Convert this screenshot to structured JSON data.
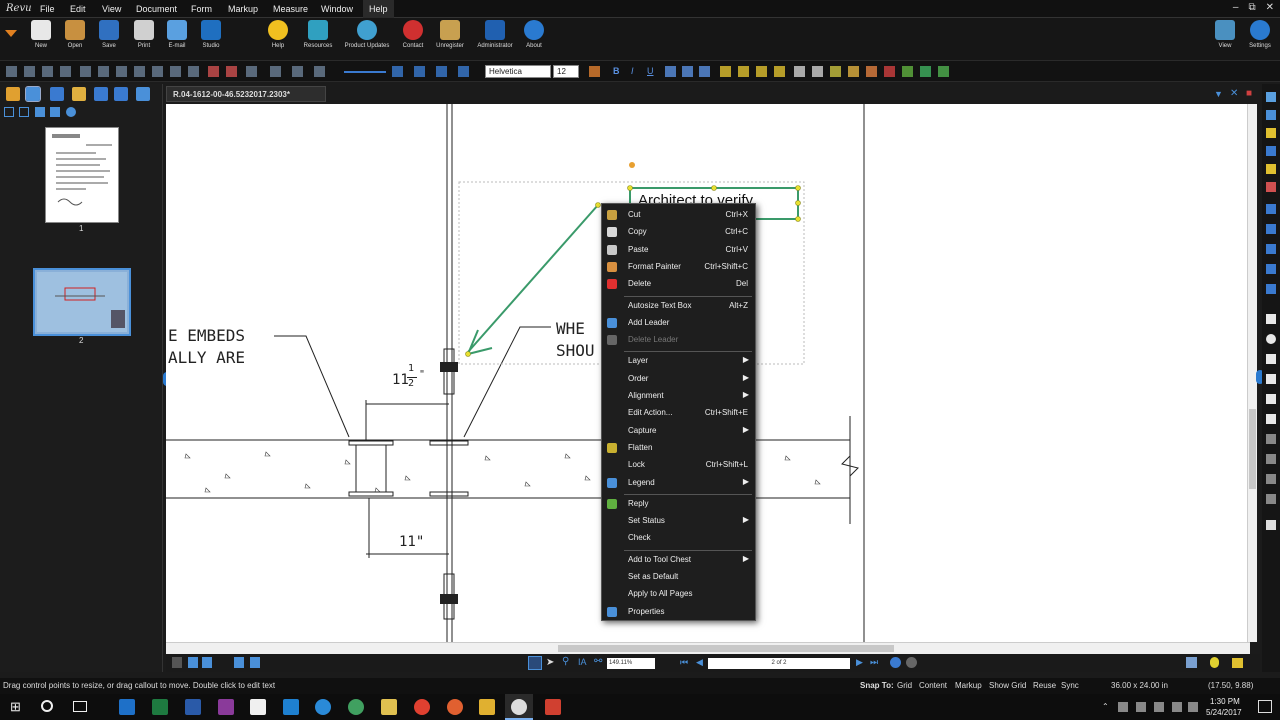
{
  "app": {
    "logo": "Revu"
  },
  "menubar": {
    "items": [
      "File",
      "Edit",
      "View",
      "Document",
      "Form",
      "Markup",
      "Measure",
      "Window",
      "Help"
    ],
    "active": "Help"
  },
  "toolbar": {
    "left": [
      "New",
      "Open",
      "Save",
      "Print",
      "E-mail",
      "Studio"
    ],
    "right": [
      "Help",
      "Resources",
      "Product Updates",
      "Contact",
      "Unregister",
      "Administrator",
      "About"
    ],
    "far_right": [
      "View",
      "Settings"
    ]
  },
  "format": {
    "font": "Helvetica",
    "size": "12",
    "bold": "B",
    "italic": "I",
    "underline": "U"
  },
  "document": {
    "tab_title": "R.04-1612-00-46.5232017.2303*"
  },
  "thumbnails": [
    {
      "number": "1"
    },
    {
      "number": "2"
    }
  ],
  "drawing": {
    "callout_text": "Architect to verify",
    "note_left_1": "E EMBEDS",
    "note_left_2": "ALLY ARE",
    "note_mid_1": "WHE",
    "note_mid_2": "SHOU",
    "dim_top": "11",
    "dim_top_frac_num": "1",
    "dim_top_frac_den": "2",
    "dim_top_mark": "\"",
    "dim_bottom": "11\""
  },
  "context_menu": {
    "items": [
      {
        "label": "Cut",
        "shortcut": "Ctrl+X",
        "icon": "scissors-icon",
        "color": "#c8a040"
      },
      {
        "label": "Copy",
        "shortcut": "Ctrl+C",
        "icon": "copy-icon",
        "color": "#d8d8d8"
      },
      {
        "label": "Paste",
        "shortcut": "Ctrl+V",
        "icon": "paste-icon",
        "color": "#c8c8c8"
      },
      {
        "label": "Format Painter",
        "shortcut": "Ctrl+Shift+C",
        "icon": "paintbrush-icon",
        "color": "#d89040"
      },
      {
        "label": "Delete",
        "shortcut": "Del",
        "icon": "delete-icon",
        "color": "#e03030"
      },
      {
        "sep": true
      },
      {
        "label": "Autosize Text Box",
        "shortcut": "Alt+Z"
      },
      {
        "label": "Add Leader",
        "shortcut": "",
        "icon": "add-leader-icon",
        "color": "#4a90d9"
      },
      {
        "label": "Delete Leader",
        "shortcut": "",
        "icon": "delete-leader-icon",
        "color": "#666",
        "disabled": true
      },
      {
        "sep": true
      },
      {
        "label": "Layer",
        "arrow": true
      },
      {
        "label": "Order",
        "arrow": true
      },
      {
        "label": "Alignment",
        "arrow": true
      },
      {
        "label": "Edit Action...",
        "shortcut": "Ctrl+Shift+E"
      },
      {
        "label": "Capture",
        "arrow": true
      },
      {
        "label": "Flatten",
        "icon": "flatten-icon",
        "color": "#c8b030"
      },
      {
        "label": "Lock",
        "shortcut": "Ctrl+Shift+L"
      },
      {
        "label": "Legend",
        "arrow": true,
        "icon": "legend-icon",
        "color": "#4a90d9"
      },
      {
        "sep": true
      },
      {
        "label": "Reply",
        "icon": "reply-icon",
        "color": "#60b040"
      },
      {
        "label": "Set Status",
        "arrow": true
      },
      {
        "label": "Check"
      },
      {
        "sep": true
      },
      {
        "label": "Add to Tool Chest",
        "arrow": true
      },
      {
        "label": "Set as Default"
      },
      {
        "label": "Apply to All Pages"
      },
      {
        "label": "Properties",
        "icon": "gear-icon",
        "color": "#4a90d9"
      }
    ]
  },
  "navbar": {
    "zoom": "149.11%",
    "page": "2 of 2"
  },
  "status": {
    "hint": "Drag control points to resize, or drag callout to move. Double click to edit text",
    "snap_to": "Snap To:",
    "toggles": [
      "Grid",
      "Content",
      "Markup",
      "Show Grid",
      "Reuse",
      "Sync"
    ],
    "size": "36.00 x 24.00 in",
    "coords": "(17.50, 9.88)"
  },
  "taskbar": {
    "time": "1:30 PM",
    "date": "5/24/2017"
  }
}
